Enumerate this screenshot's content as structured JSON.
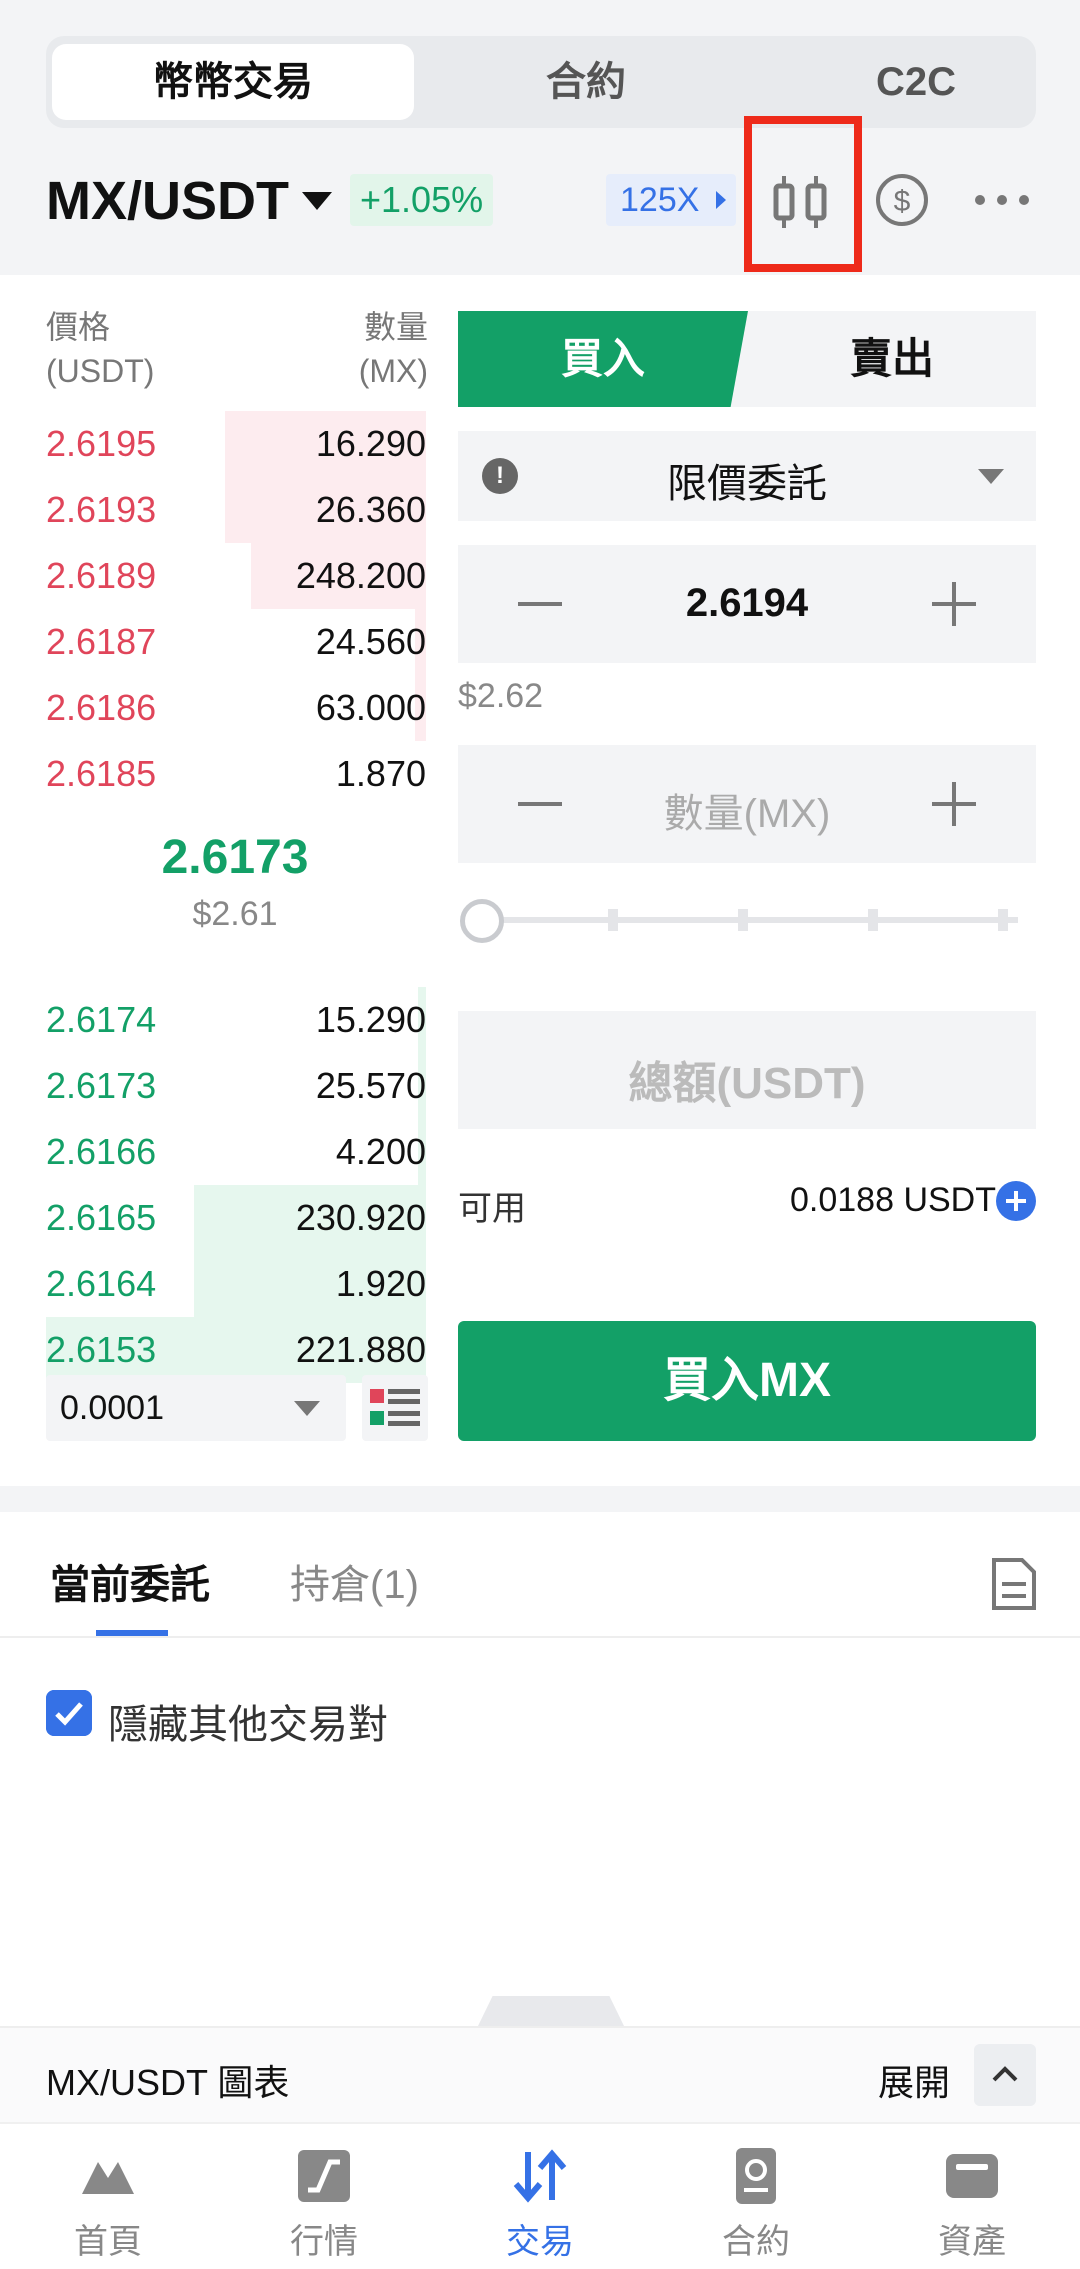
{
  "segments": [
    "幣幣交易",
    "合約",
    "C2C"
  ],
  "header": {
    "pair": "MX/USDT",
    "change": "+1.05%",
    "leverage": "125X",
    "icons": [
      "candlestick-chart-icon",
      "dollar-circle-icon",
      "more-icon"
    ],
    "highlight_color": "#ee2a1a"
  },
  "orderbook": {
    "price_header": [
      "價格",
      "(USDT)"
    ],
    "qty_header": [
      "數量",
      "(MX)"
    ],
    "asks": [
      {
        "price": "2.6195",
        "qty": "16.290",
        "depth": 0.53
      },
      {
        "price": "2.6193",
        "qty": "26.360",
        "depth": 0.53
      },
      {
        "price": "2.6189",
        "qty": "248.200",
        "depth": 0.46
      },
      {
        "price": "2.6187",
        "qty": "24.560",
        "depth": 0.03
      },
      {
        "price": "2.6186",
        "qty": "63.000",
        "depth": 0.03
      },
      {
        "price": "2.6185",
        "qty": "1.870",
        "depth": 0
      }
    ],
    "mid_price": "2.6173",
    "mid_usd": "$2.61",
    "bids": [
      {
        "price": "2.6174",
        "qty": "15.290",
        "depth": 0.02
      },
      {
        "price": "2.6173",
        "qty": "25.570",
        "depth": 0.02
      },
      {
        "price": "2.6166",
        "qty": "4.200",
        "depth": 0.02
      },
      {
        "price": "2.6165",
        "qty": "230.920",
        "depth": 0.61
      },
      {
        "price": "2.6164",
        "qty": "1.920",
        "depth": 0.61
      },
      {
        "price": "2.6153",
        "qty": "221.880",
        "depth": 1.0
      }
    ],
    "depth_precision": "0.0001"
  },
  "form": {
    "buy_tab": "買入",
    "sell_tab": "賣出",
    "order_type": "限價委託",
    "price": "2.6194",
    "price_usd": "$2.62",
    "qty_placeholder": "數量(MX)",
    "total_placeholder": "總額(USDT)",
    "available_label": "可用",
    "available_value": "0.0188 USDT",
    "buy_button": "買入MX",
    "slider_percent": 0
  },
  "orders": {
    "tab_current": "當前委託",
    "tab_positions": "持倉(1)",
    "hide_others": "隱藏其他交易對",
    "hide_checked": true
  },
  "chart_bar": {
    "title": "MX/USDT 圖表",
    "expand": "展開"
  },
  "nav": [
    {
      "label": "首頁",
      "icon": "home-icon",
      "active": false
    },
    {
      "label": "行情",
      "icon": "market-icon",
      "active": false
    },
    {
      "label": "交易",
      "icon": "trade-icon",
      "active": true
    },
    {
      "label": "合約",
      "icon": "futures-icon",
      "active": false
    },
    {
      "label": "資產",
      "icon": "wallet-icon",
      "active": false
    }
  ],
  "colors": {
    "green": "#13a067",
    "red": "#e0455a",
    "blue": "#3571e6"
  }
}
